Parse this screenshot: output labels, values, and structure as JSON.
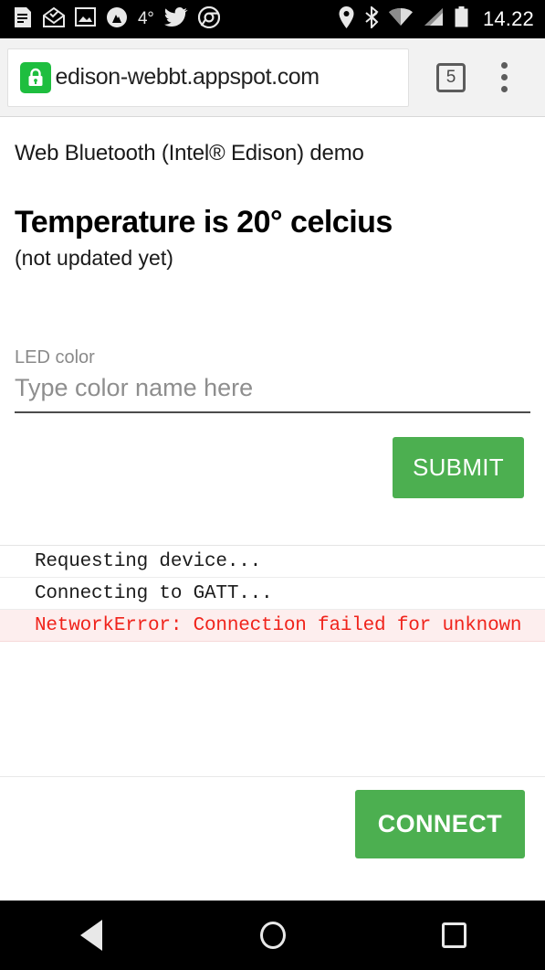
{
  "statusbar": {
    "left_icons": [
      "article-icon",
      "mail-open-icon",
      "photo-icon",
      "mountain-app-icon"
    ],
    "temperature": "4°",
    "social_icons": [
      "twitter-icon",
      "chrome-icon"
    ],
    "right_icons": [
      "location-pin-icon",
      "bluetooth-icon",
      "wifi-icon",
      "cellular-signal-icon",
      "battery-icon"
    ],
    "time": "14.22"
  },
  "browser": {
    "lock_icon": "lock-icon",
    "url": "/edison-webbt.appspot.com",
    "tab_count": "5",
    "menu_icon": "overflow-menu-icon"
  },
  "page": {
    "subtitle": "Web Bluetooth (Intel® Edison) demo",
    "temperature_heading": "Temperature is 20° celcius",
    "temperature_note": "(not updated yet)",
    "field": {
      "label": "LED color",
      "placeholder": "Type color name here",
      "value": ""
    },
    "submit_label": "SUBMIT",
    "connect_label": "CONNECT",
    "log": [
      {
        "text": "Requesting device...",
        "type": "info"
      },
      {
        "text": "Connecting to GATT...",
        "type": "info"
      },
      {
        "text": "NetworkError: Connection failed for unknown",
        "type": "error"
      }
    ]
  },
  "navbar": {
    "back": "back-icon",
    "home": "home-icon",
    "recents": "recents-icon"
  },
  "colors": {
    "accent_green": "#4caf50",
    "lock_green": "#1ebe3f",
    "error_red": "#f0231b",
    "error_bg": "#fdeeee"
  }
}
